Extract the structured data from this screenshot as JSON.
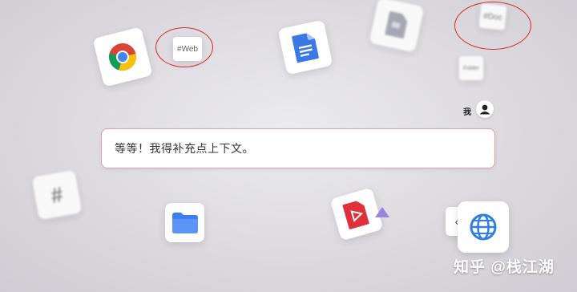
{
  "tags": {
    "web": "#Web",
    "doc": "#Doc",
    "folder": "Folder",
    "hash": "#"
  },
  "chat": {
    "user_label": "我",
    "message": "等等！我得补充点上下文。"
  },
  "watermark": "知乎 @栈江湖",
  "icons": [
    "chrome-icon",
    "google-docs-icon",
    "file-icon",
    "folder-icon",
    "pdf-icon",
    "globe-icon",
    "user-icon",
    "hash-icon"
  ],
  "colors": {
    "highlight_circle": "#d62a2a",
    "chat_border": "#e0a0a8",
    "docs_blue": "#3b78e7",
    "folder_blue": "#3d7ff0",
    "pdf_red": "#e0313a",
    "globe_blue": "#2f7fe0"
  }
}
